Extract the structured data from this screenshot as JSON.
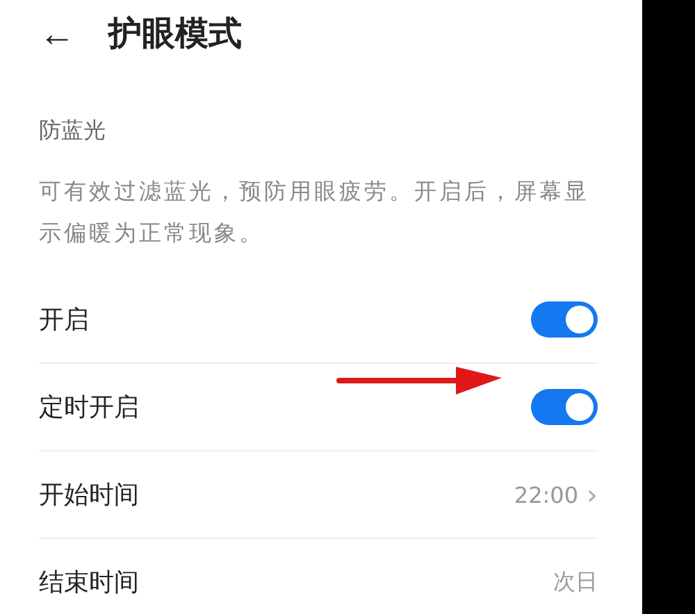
{
  "header": {
    "back": "←",
    "title": "护眼模式"
  },
  "section": {
    "title": "防蓝光",
    "description": "可有效过滤蓝光，预防用眼疲劳。开启后，屏幕显示偏暖为正常现象。"
  },
  "rows": [
    {
      "kind": "toggle",
      "label": "开启",
      "on": true
    },
    {
      "kind": "toggle",
      "label": "定时开启",
      "on": true,
      "arrow": true
    },
    {
      "kind": "value",
      "label": "开始时间",
      "value": "22:00",
      "chevron": "›"
    },
    {
      "kind": "value",
      "label": "结束时间",
      "value": "次日"
    }
  ]
}
